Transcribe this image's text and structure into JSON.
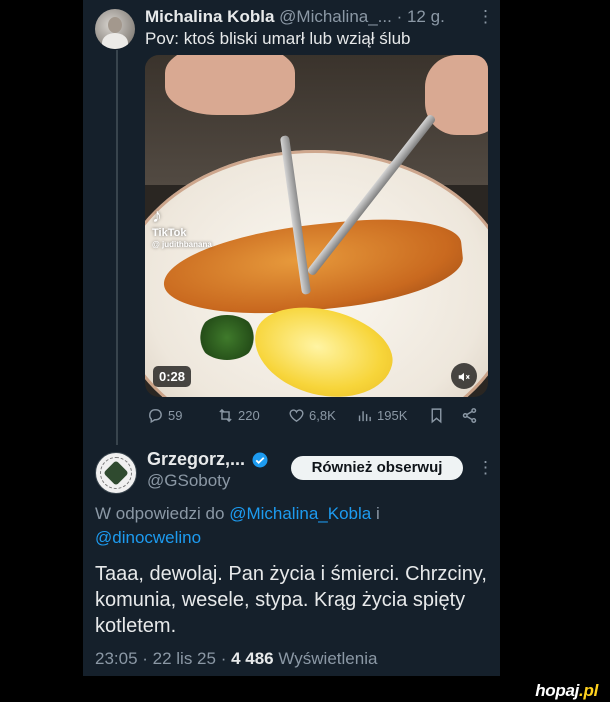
{
  "tweet1": {
    "author_name": "Michalina Kobla",
    "handle": "@Michalina_...",
    "time": "· 12 g.",
    "more": "⋮",
    "text": "Pov: ktoś bliski umarł lub wziął ślub",
    "media": {
      "tiktok_logo": "♪",
      "tiktok_label": "TikTok",
      "tiktok_user": "@ judithbanana",
      "duration": "0:28",
      "mute_icon": "speaker-muted-icon"
    },
    "actions": {
      "replies": "59",
      "reposts": "220",
      "likes": "6,8K",
      "views": "195K"
    }
  },
  "tweet2": {
    "author_name": "Grzegorz,...",
    "handle": "@GSoboty",
    "follow_label": "Również obserwuj",
    "more": "⋮",
    "reply_prefix": "W odpowiedzi do",
    "reply_mention1": "@Michalina_Kobla",
    "reply_and": "i",
    "reply_mention2": "@dinocwelino",
    "text": "Taaa, dewolaj. Pan życia i śmierci. Chrzciny, komunia, wesele, stypa. Krąg życia spięty kotletem.",
    "time": "23:05 · 22 lis 25 ·",
    "views_count": "4 486",
    "views_label": "Wyświetlenia"
  },
  "watermark": {
    "name": "hopaj",
    "dot": ".",
    "tld": "pl"
  },
  "colors": {
    "background": "#15202b",
    "accent": "#1d9bf0",
    "muted": "#8b98a5",
    "verified": "#1d9bf0"
  }
}
